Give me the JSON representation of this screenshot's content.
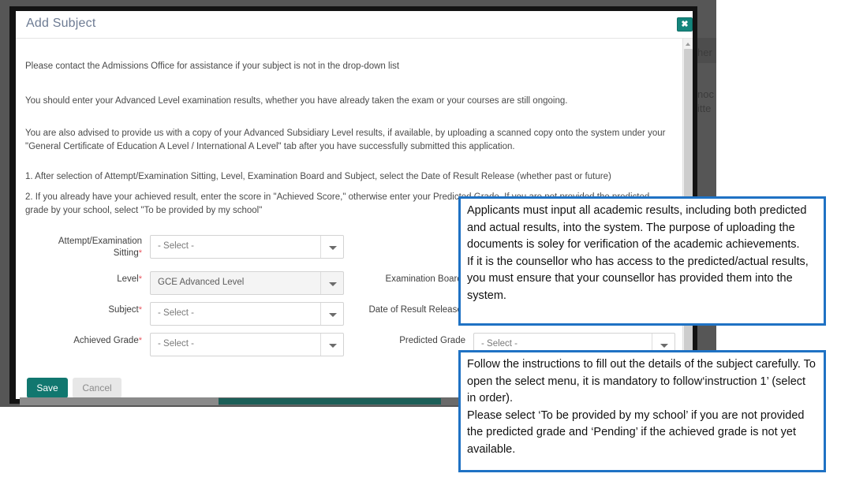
{
  "background": {
    "fragments": [
      "her",
      "noc",
      "itte"
    ]
  },
  "dialog": {
    "title": "Add Subject",
    "close_label": "✖",
    "paragraphs": [
      "Please contact the Admissions Office for assistance if your subject is not in the drop-down list",
      "You should enter your Advanced Level examination results, whether you have already taken the exam or your courses are still ongoing.",
      "You are also advised to provide us with a copy of your Advanced Subsidiary Level results, if available, by uploading a scanned copy onto the system under your \"General Certificate of Education A Level / International A Level\" tab after you have successfully submitted this application.",
      "1. After selection of Attempt/Examination Sitting, Level, Examination Board and Subject, select the Date of Result Release (whether past or future)",
      "2. If you already have your achieved result, enter the score in \"Achieved Score,\" otherwise enter your Predicted Grade. If you are not provided the predicted grade by your school, select \"To be provided by my school\""
    ],
    "form": {
      "placeholder_select": "- Select -",
      "required_marker": "*",
      "fields": [
        {
          "label": "Attempt/Examination Sitting",
          "required": true,
          "value": "- Select -",
          "filled": false
        },
        {
          "label": "Level",
          "required": true,
          "value": "GCE Advanced Level",
          "filled": true
        },
        {
          "label": "Subject",
          "required": true,
          "value": "- Select -",
          "filled": false
        },
        {
          "label": "Achieved Grade",
          "required": true,
          "value": "- Select -",
          "filled": false
        },
        {
          "label": "Examination Board",
          "required": true,
          "value": "",
          "filled": false
        },
        {
          "label": "Date of Result Release",
          "required": true,
          "value": "",
          "filled": false
        },
        {
          "label": "Predicted Grade",
          "required": false,
          "value": "- Select -",
          "filled": false
        }
      ]
    },
    "buttons": {
      "save": "Save",
      "cancel": "Cancel"
    }
  },
  "annotations": [
    {
      "id": "annotation-results-entry",
      "text": "Applicants must input all academic results, including both predicted and actual results, into the system. The purpose of uploading the documents is soley for verification of the academic achievements.\nIf it is the counsellor who has access to the predicted/actual results, you must ensure that your counsellor has provided them into the system.",
      "border_color": "#1f72c4"
    },
    {
      "id": "annotation-instructions",
      "text": "Follow the instructions to fill out the details of the subject carefully. To open the select menu, it is mandatory to follow‘instruction 1’ (select in order).\nPlease select ‘To be provided by my school’ if you are not provided the predicted grade and ‘Pending’ if the achieved grade is not yet available.",
      "border_color": "#1f72c4"
    }
  ],
  "colors": {
    "accent_teal": "#11776f",
    "callout_blue": "#1f72c4",
    "required_red": "#e8565f",
    "title_blue_grey": "#6d7b93"
  }
}
